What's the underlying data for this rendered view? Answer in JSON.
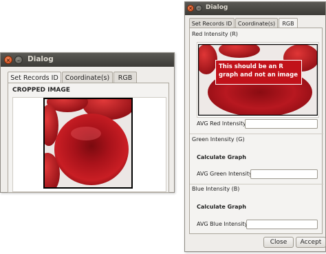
{
  "left_dialog": {
    "title": "Dialog",
    "tabs": [
      {
        "label": "Set Records ID",
        "active": true
      },
      {
        "label": "Coordinate(s)",
        "active": false
      },
      {
        "label": "RGB",
        "active": false
      }
    ],
    "section_label": "CROPPED IMAGE",
    "image": "red-blood-cell-photo"
  },
  "right_dialog": {
    "title": "Dialog",
    "tabs": [
      {
        "label": "Set Records ID",
        "active": false
      },
      {
        "label": "Coordinate(s)",
        "active": false
      },
      {
        "label": "RGB",
        "active": true
      }
    ],
    "red": {
      "section_label": "Red Intensity (R)",
      "annotation": "This should be an R graph and not an image",
      "avg_label": "AVG Red Intensity",
      "avg_value": ""
    },
    "green": {
      "section_label": "Green Intensity (G)",
      "calc_label": "Calculate Graph",
      "avg_label": "AVG Green Intensity",
      "avg_value": ""
    },
    "blue": {
      "section_label": "Blue Intensity (B)",
      "calc_label": "Calculate Graph",
      "avg_label": "AVG Blue Intensity",
      "avg_value": ""
    },
    "buttons": {
      "close": "Close",
      "accept": "Accept"
    }
  },
  "colors": {
    "titlebar": "#3c3b37",
    "window_bg": "#efedea",
    "close_button": "#e05a1e",
    "annotation_box": "#c1121a",
    "cell_red": "#b4141b"
  }
}
